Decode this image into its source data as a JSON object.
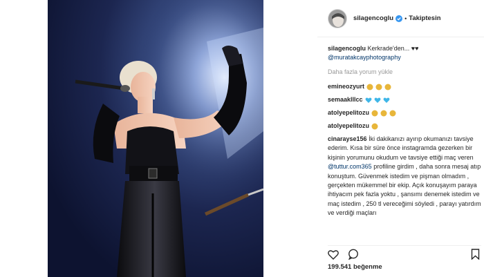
{
  "post": {
    "username": "silagencoglu",
    "follow_label": "Takiptesin",
    "separator": "•",
    "caption_text": "Kerkrade'den... ♥♥",
    "caption_mention": "@muratakcayphotography",
    "load_more_label": "Daha fazla yorum yükle",
    "likes_count": "199.541",
    "likes_label": "beğenme"
  },
  "comments": [
    {
      "user": "emineozyurt",
      "emoji": "clap",
      "count": 3
    },
    {
      "user": "semaaklllcc",
      "emoji": "blue-heart",
      "count": 3
    },
    {
      "user": "atolyepelitozu",
      "emoji": "clap",
      "count": 3
    },
    {
      "user": "atolyepelitozu",
      "emoji": "clap",
      "count": 1
    }
  ],
  "long_comment": {
    "user": "cinarayse156",
    "text_1": "İki dakikanızı ayırıp okumanızı tavsiye ederim. Kısa bir süre önce instagramda gezerken bir kişinin yorumunu okudum ve tavsiye ettiği maç veren",
    "mention": "@tuttur.com365",
    "text_2": "profiline girdim , daha sonra mesaj atıp konuştum. Güvenmek istedim ve pişman olmadım , gerçekten mükemmel bir ekip. Açık konuşayım paraya ihtiyacım pek fazla yoktu , şansımı denemek istedim ve maç istedim , 250 tl vereceğimi söyledi , parayı yatırdım ve verdiği maçları"
  },
  "icons": {
    "verified": "verified-badge-icon",
    "heart": "heart-icon",
    "comment": "comment-icon",
    "bookmark": "bookmark-icon",
    "clap": "clapping-hands-icon",
    "blue_heart": "blue-heart-icon"
  },
  "colors": {
    "verified_blue": "#3897f0",
    "mention_link": "#003569",
    "muted_text": "#999999",
    "blue_heart": "#3fb6e8",
    "clap": "#e8b63a"
  }
}
